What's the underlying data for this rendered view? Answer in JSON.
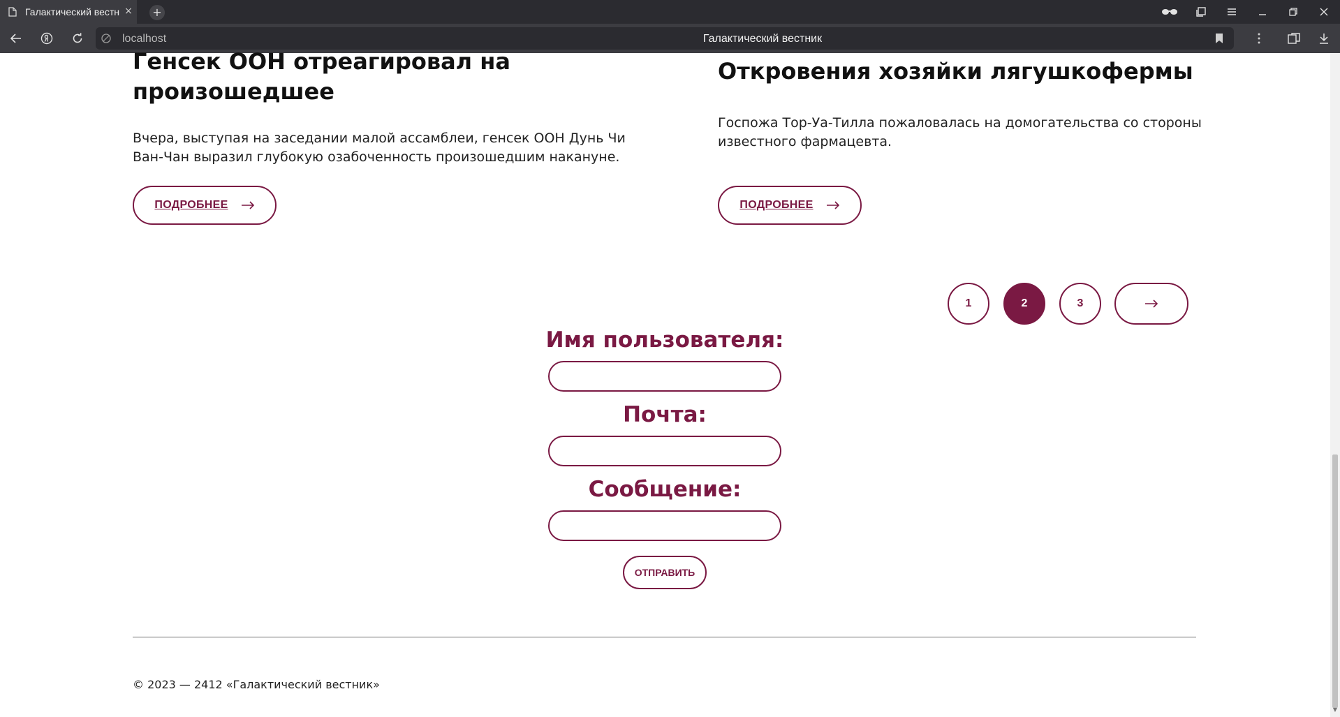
{
  "browser": {
    "tab_title": "Галактический вестник",
    "tab_close": "×",
    "new_tab": "+",
    "url": "localhost",
    "page_title": "Галактический вестник"
  },
  "articles": [
    {
      "title": "Генсек ООН отреагировал на произошедшее",
      "text": "Вчера, выступая на заседании малой ассамблеи, генсек ООН Дунь Чи Ван-Чан выразил глубокую озабоченность произошедшим накануне.",
      "more_label": "ПОДРОБНЕЕ"
    },
    {
      "title": "Откровения хозяйки лягушкофермы",
      "text": "Госпожа Тор-Уа-Тилла пожаловалась на домогательства со стороны известного фармацевта.",
      "more_label": "ПОДРОБНЕЕ"
    }
  ],
  "pagination": {
    "pages": [
      "1",
      "2",
      "3"
    ],
    "active_page": "2"
  },
  "form": {
    "username_label": "Имя пользователя:",
    "username_value": "",
    "email_label": "Почта:",
    "email_value": "",
    "message_label": "Сообщение:",
    "message_value": "",
    "submit_label": "ОТПРАВИТЬ"
  },
  "footer": {
    "copyright": "© 2023 — 2412 «Галактический вестник»"
  },
  "colors": {
    "accent": "#7a1943",
    "chrome_dark": "#2b2b30",
    "chrome_mid": "#3c3c41"
  }
}
